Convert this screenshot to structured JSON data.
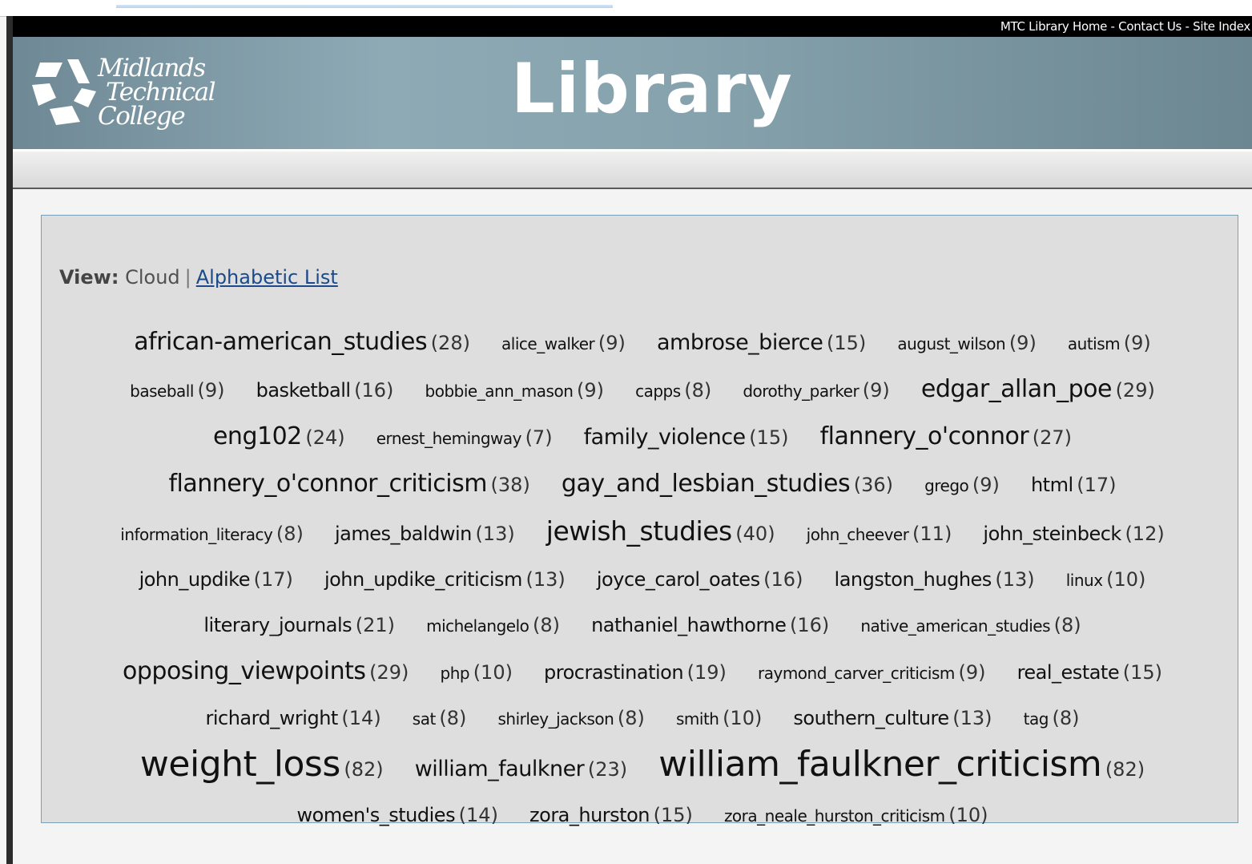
{
  "header": {
    "links": [
      "MTC Library Home",
      "Contact Us",
      "Site Index"
    ],
    "separator": " - ",
    "logo_lines": [
      "Midlands",
      "Technical",
      "College"
    ],
    "title": "Library"
  },
  "view": {
    "label": "View:",
    "current": "Cloud",
    "separator": "|",
    "alt_link": "Alphabetic List"
  },
  "tags": [
    {
      "name": "african-american_studies",
      "count": "(28)",
      "size": 4
    },
    {
      "name": "alice_walker",
      "count": "(9)",
      "size": 1
    },
    {
      "name": "ambrose_bierce",
      "count": "(15)",
      "size": 3
    },
    {
      "name": "august_wilson",
      "count": "(9)",
      "size": 1
    },
    {
      "name": "autism",
      "count": "(9)",
      "size": 1
    },
    {
      "name": "baseball",
      "count": "(9)",
      "size": 1
    },
    {
      "name": "basketball",
      "count": "(16)",
      "size": 2
    },
    {
      "name": "bobbie_ann_mason",
      "count": "(9)",
      "size": 1
    },
    {
      "name": "capps",
      "count": "(8)",
      "size": 1
    },
    {
      "name": "dorothy_parker",
      "count": "(9)",
      "size": 1
    },
    {
      "name": "edgar_allan_poe",
      "count": "(29)",
      "size": 4
    },
    {
      "name": "eng102",
      "count": "(24)",
      "size": 4
    },
    {
      "name": "ernest_hemingway",
      "count": "(7)",
      "size": 1
    },
    {
      "name": "family_violence",
      "count": "(15)",
      "size": 3
    },
    {
      "name": "flannery_o'connor",
      "count": "(27)",
      "size": 4
    },
    {
      "name": "flannery_o'connor_criticism",
      "count": "(38)",
      "size": 4
    },
    {
      "name": "gay_and_lesbian_studies",
      "count": "(36)",
      "size": 4
    },
    {
      "name": "grego",
      "count": "(9)",
      "size": 1
    },
    {
      "name": "html",
      "count": "(17)",
      "size": 2
    },
    {
      "name": "information_literacy",
      "count": "(8)",
      "size": 1
    },
    {
      "name": "james_baldwin",
      "count": "(13)",
      "size": 2
    },
    {
      "name": "jewish_studies",
      "count": "(40)",
      "size": 5
    },
    {
      "name": "john_cheever",
      "count": "(11)",
      "size": 1
    },
    {
      "name": "john_steinbeck",
      "count": "(12)",
      "size": 2
    },
    {
      "name": "john_updike",
      "count": "(17)",
      "size": 2
    },
    {
      "name": "john_updike_criticism",
      "count": "(13)",
      "size": 2
    },
    {
      "name": "joyce_carol_oates",
      "count": "(16)",
      "size": 2
    },
    {
      "name": "langston_hughes",
      "count": "(13)",
      "size": 2
    },
    {
      "name": "linux",
      "count": "(10)",
      "size": 1
    },
    {
      "name": "literary_journals",
      "count": "(21)",
      "size": 2
    },
    {
      "name": "michelangelo",
      "count": "(8)",
      "size": 1
    },
    {
      "name": "nathaniel_hawthorne",
      "count": "(16)",
      "size": 2
    },
    {
      "name": "native_american_studies",
      "count": "(8)",
      "size": 1
    },
    {
      "name": "opposing_viewpoints",
      "count": "(29)",
      "size": 4
    },
    {
      "name": "php",
      "count": "(10)",
      "size": 1
    },
    {
      "name": "procrastination",
      "count": "(19)",
      "size": 2
    },
    {
      "name": "raymond_carver_criticism",
      "count": "(9)",
      "size": 1
    },
    {
      "name": "real_estate",
      "count": "(15)",
      "size": 2
    },
    {
      "name": "richard_wright",
      "count": "(14)",
      "size": 2
    },
    {
      "name": "sat",
      "count": "(8)",
      "size": 1
    },
    {
      "name": "shirley_jackson",
      "count": "(8)",
      "size": 1
    },
    {
      "name": "smith",
      "count": "(10)",
      "size": 1
    },
    {
      "name": "southern_culture",
      "count": "(13)",
      "size": 2
    },
    {
      "name": "tag",
      "count": "(8)",
      "size": 1
    },
    {
      "name": "weight_loss",
      "count": "(82)",
      "size": 6
    },
    {
      "name": "william_faulkner",
      "count": "(23)",
      "size": 3
    },
    {
      "name": "william_faulkner_criticism",
      "count": "(82)",
      "size": 6
    },
    {
      "name": "women's_studies",
      "count": "(14)",
      "size": 2
    },
    {
      "name": "zora_hurston",
      "count": "(15)",
      "size": 2
    },
    {
      "name": "zora_neale_hurston_criticism",
      "count": "(10)",
      "size": 1
    }
  ]
}
